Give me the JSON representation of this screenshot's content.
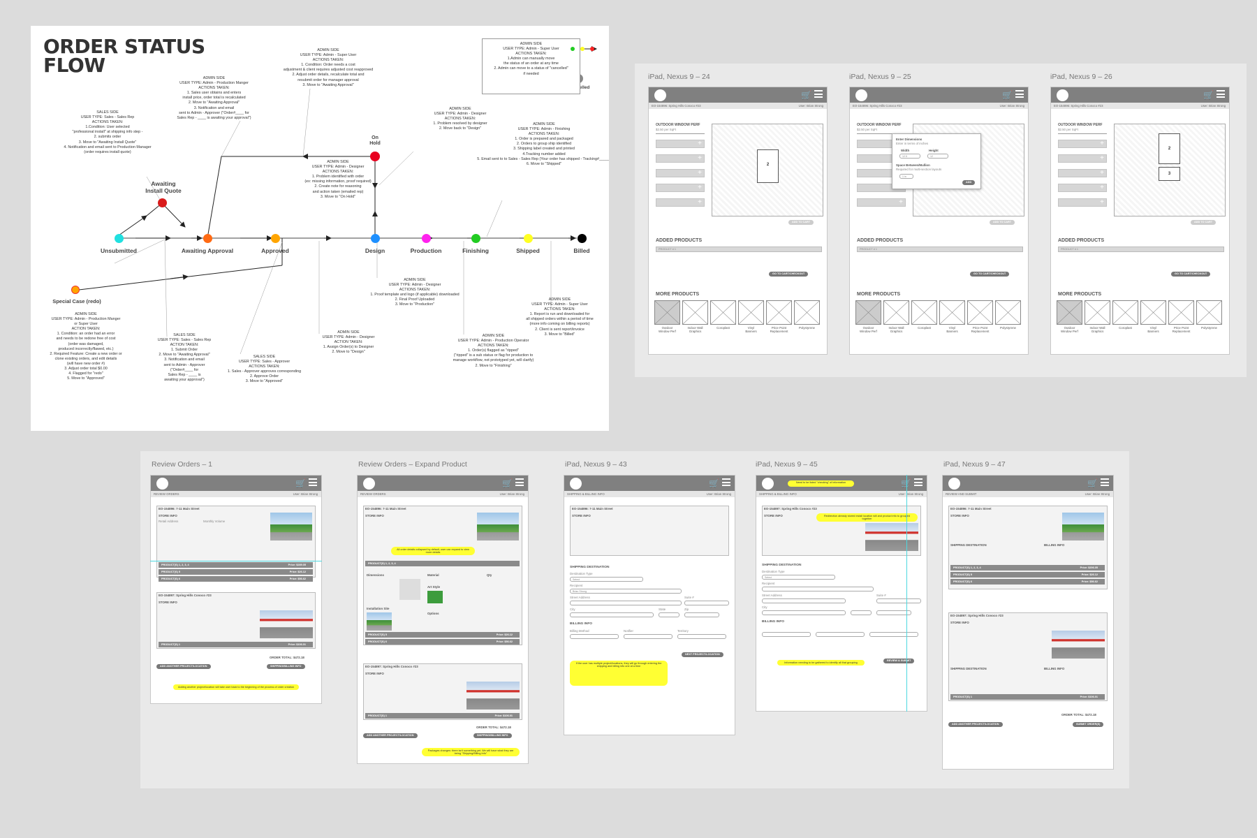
{
  "flow": {
    "title_line1": "ORDER STATUS",
    "title_line2": "FLOW",
    "stages": [
      {
        "label": "Unsubmitted",
        "color": "#20e0e0"
      },
      {
        "label": "Awaiting Approval",
        "color": "#ff6a13"
      },
      {
        "label": "Approved",
        "color": "#ffa500"
      },
      {
        "label": "Design",
        "color": "#1e90ff"
      },
      {
        "label": "Production",
        "color": "#ff22ee"
      },
      {
        "label": "Finishing",
        "color": "#22cc22"
      },
      {
        "label": "Shipped",
        "color": "#ffff22"
      },
      {
        "label": "Billed",
        "color": "#000000"
      }
    ],
    "awaiting_install_quote": "Awaiting\nInstall Quote",
    "on_hold": "On\nHold",
    "special_case": "Special Case (redo)",
    "cancelled": "Cancelled",
    "legend_colors": [
      "#000000",
      "#22cc22",
      "#ffff22",
      "#ff2222",
      "#000000"
    ],
    "notes": {
      "legend": "ADMIN SIDE\nUSER TYPE: Admin - Super User\nACTIONS TAKEN:\n1.Admin can manually move\nthe status of an order at any time\n2. Admin can move to a status of \"cancelled\"\nif needed",
      "super_cost": "ADMIN SIDE\nUSER TYPE: Admin - Super User\nACTIONS TAKEN:\n1. Condition: Order needs a cost\nadjustment & client requires adjusted cost reapproved\n2. Adjust order details, recalculate total and\nresubmit order for manager approval\n3. Move to \"Awaiting Approval\"",
      "production_manager": "ADMIN SIDE\nUSER TYPE: Admin - Production Manger\nACTIONS TAKEN:\n1. Sales user obtains and enters\ninstall price, order total is recalculated\n2. Move to \"Awaiting Approval\"\n3. Notification and email\nsent to Admin - Approver (\"Order#____ for\nSales Rep - ____ is awaiting your approval\")",
      "sales_rep_quote": "SALES SIDE\nUSER TYPE: Sales - Sales Rep\nACTIONS TAKEN:\n1.Condition: User selected\n\"professional install\" at shipping info step -\n2. submits order\n3. Move to \"Awaiting Install Quote\"\n4. Notification and email sent to Production Manager\n(order requires install quote)",
      "designer_hold": "ADMIN SIDE\nUSER TYPE: Admin - Designer\nACTIONS TAKEN:\n1. Problem resolved by designer\n2. Move back to \"Design\"",
      "finishing": "ADMIN SIDE\nUSER TYPE: Admin - Finishing\nACTIONS TAKEN:\n1. Order is prepared and packaged\n2. Orders to group ship identified\n3. Shipping label created and printed\n4.Tracking number added\n5. Email sent to to Sales - Sales Rep (Your order has shipped - Tracking#_____)\n6. Move to \"Shipped\"",
      "designer_problem": "ADMIN SIDE\nUSER TYPE: Admin - Designer\nACTIONS TAKEN:\n1. Problem identified with order\n(ex: missing information, proof required)\n2. Create note for reasoning\nand action taken (emailed rep)\n3. Move to \"On Hold\"",
      "designer_proof": "ADMIN SIDE\nUSER TYPE: Admin - Designer\nACTIONS TAKEN:\n1. Proof template and logo (if applicable) downloaded\n2. Final Proof Uploaded\n3. Move to \"Production\"",
      "super_billed": "ADMIN SIDE\nUSER TYPE: Admin - Super User\nACTIONS TAKEN:\n1. Report is run and downloaded for\nall shipped orders within a period of time\n(more info coming on billing reports)\n2. Client is sent report/invoice\n3. Move to \"Billed\"",
      "production_operator": "ADMIN SIDE\nUSER TYPE: Admin - Production Operator\nACTIONS TAKEN:\n1. Order(s) flagged as \"ripped\"\n(\"ripped\" is a sub status or flag for production to\nmanage workflow, not prototyped yet, will clarify)\n2. Move to \"Finishing\"",
      "designer_assign": "ADMIN SIDE\nUSER TYPE: Admin - Designer\nACTION TAKEN:\n1. Assign Order(s) to Designer\n2. Move to \"Design\"",
      "sales_approver": "SALES SIDE\nUSER TYPE: Sales - Approver\nACTIONS TAKEN:\n1. Sales - Approver approves corresponding\n2. Approve Order\n3. Move to \"Approved\"",
      "sales_rep_submit": "SALES SIDE\nUSER TYPE: Sales - Sales Rep\nACTION TAKEN:\n1. Submit Order\n2. Move to \"Awaiting Approval\"\n3. Notification and email\nsent to Admin - Approver\n(\"Order#____ for\nSales Rep - ____ is\nawaiting your approval\")",
      "special_case": "ADMIN SIDE\nUSER TYPE: Admin - Production Manger\nor Super User\nACTION TAKEN:\n1. Condition: an order had an error\nand needs to be redone free of cost\n(order was damaged,\nproduced incorrectly/flawed, etc.)\n2. Required Feature: Create a new order or\nclone existing orders, and edit details\n(will have new order #)\n3. Adjust order total $0.00\n4. Flagged for \"redo\"\n5. Move to \"Approved\""
    }
  },
  "top_board": {
    "screens": [
      {
        "label": "iPad, Nexus 9 – 24"
      },
      {
        "label": "iPad, Nexus 9 – 25"
      },
      {
        "label": "iPad, Nexus 9 – 26"
      }
    ],
    "order_id": "EO-154896: Spring Hills Conoco #23",
    "user": "User: Brian Strong",
    "product_title": "OUTDOOR WINDOW PERF",
    "product_price": "$2.50 per SqFt",
    "added_products": "ADDED PRODUCTS",
    "product_row": "PRODUCT # 1",
    "add_to_cart": "ADD TO CART",
    "go_to_cart": "GO TO CART/CHECKOUT",
    "more_products": "MORE PRODUCTS",
    "product_types": [
      "Outdoor\nWindow Perf",
      "Indoor Wall\nGraphics",
      "Coroplast",
      "Vinyl\nBanners",
      "Price Point\nReplacement",
      "Polystyrene"
    ],
    "popup": {
      "title": "Enter Dimensions",
      "subtitle": "Enter in terms of inches",
      "width_label": "Width",
      "height_label": "Height",
      "width_val": "12.5",
      "height_val": "12",
      "space_label": "Space Between/Mullion",
      "space_note": "Required for multi-section layouts",
      "space_val": "1 in",
      "add": "ADD"
    },
    "canvas_labels": [
      "2",
      "2",
      "3"
    ]
  },
  "bottom_board": {
    "screens": [
      {
        "label": "Review Orders – 1",
        "section": "REVIEW ORDERS"
      },
      {
        "label": "Review Orders – Expand Product",
        "section": "REVIEW ORDERS"
      },
      {
        "label": "iPad, Nexus 9 – 43",
        "section": "SHIPPING & BILLING INFO"
      },
      {
        "label": "iPad, Nexus 9 – 45",
        "section": "SHIPPING & BILLING INFO"
      },
      {
        "label": "iPad, Nexus 9 – 47",
        "section": "REVIEW AND SUBMIT"
      }
    ],
    "store1": "EO-154896: 7-11 Main Street",
    "store2": "EO-154897: Spring Hills Conoco #23",
    "store_info": "STORE INFO",
    "products1": "PRODUCT(S) 1, 2, 3, 4",
    "products_single": "PRODUCT(S) 1",
    "price1": "Price: $289.05",
    "price2": "Price: $26.12",
    "price3": "Price: $56.62",
    "price4": "Price: $106.01",
    "order_total": "ORDER TOTAL: $472.18",
    "add_another": "ADD ANOTHER PROJECT/LOCATION",
    "shipping_btn": "SHIPPING/BILLING INFO",
    "next_btn": "NEXT PROJECT/LOCATION",
    "review_btn": "REVIEW & SUBMIT",
    "submit_btn": "SUBMIT ORDER(S)",
    "shipping_dest": "SHIPPING DESTINATION",
    "billing_info": "BILLING INFO",
    "destination_type": "Destination Type",
    "recipient": "Recipient",
    "street": "Street Address",
    "city": "City",
    "state": "State",
    "zip": "Zip",
    "suite": "Suite #",
    "billing_method": "Billing Method",
    "notifier": "Notifier",
    "territory": "Territory",
    "sticky_notes": [
      "Adding another project/location will take user back to the beginning of the process of order creation",
      "All order details collapsed by default, user can expand to view more details",
      "Packages changes: there isn't something yet. We will have what they are being \"Shipping/Billing Info\"",
      "If the user has multiple project/locations, they will go through entering the shipping and billing info one at a time",
      "Need to be listed \"checking\" of information",
      "Information needing to be gathered to identify all that grouping",
      "Redirection already stored install location will and product info to grouped together"
    ],
    "dimensions_label": "Dimensions",
    "material_label": "Material",
    "art_style_label": "Art Style",
    "qty_label": "Qty",
    "options_label": "Options",
    "installation_site": "Installation Site",
    "retail_address": "Retail Address",
    "monthly_volume": "Monthly Volume"
  }
}
